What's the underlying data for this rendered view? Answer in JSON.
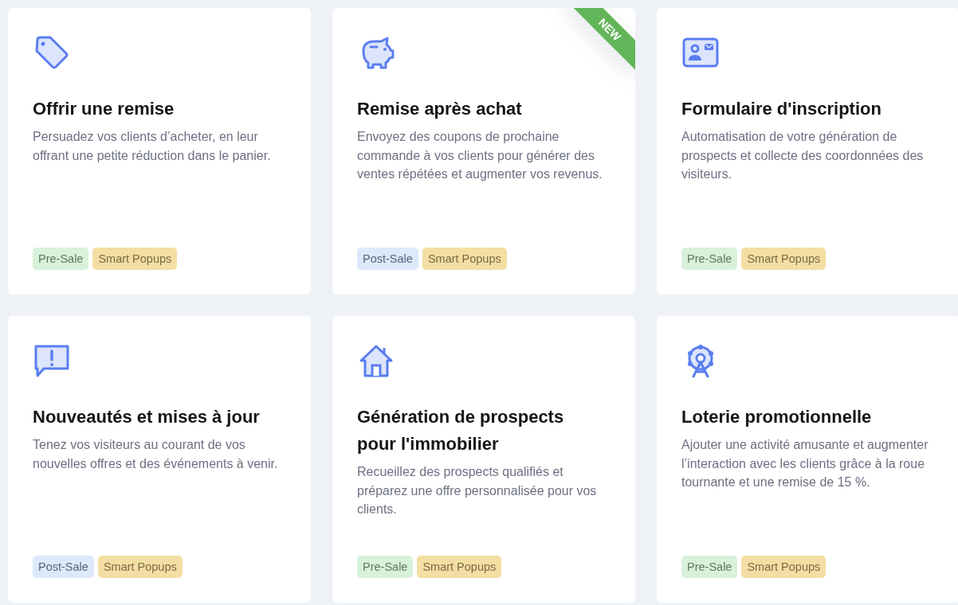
{
  "cards": [
    {
      "title": "Offrir une remise",
      "description": "Persuadez vos clients d’acheter, en leur offrant une petite réduction dans le panier.",
      "tags": [
        {
          "label": "Pre-Sale",
          "kind": "presale"
        },
        {
          "label": "Smart Popups",
          "kind": "smart"
        }
      ]
    },
    {
      "title": "Remise après achat",
      "description": "Envoyez des coupons de prochaine commande à vos clients pour générer des ventes répétées et augmenter vos revenus.",
      "ribbon": "NEW",
      "tags": [
        {
          "label": "Post-Sale",
          "kind": "postsale"
        },
        {
          "label": "Smart Popups",
          "kind": "smart"
        }
      ]
    },
    {
      "title": "Formulaire d'inscription",
      "description": "Automatisation de votre génération de prospects et collecte des coordonnées des visiteurs.",
      "tags": [
        {
          "label": "Pre-Sale",
          "kind": "presale"
        },
        {
          "label": "Smart Popups",
          "kind": "smart"
        }
      ]
    },
    {
      "title": "Nouveautés et mises à jour",
      "description": "Tenez vos visiteurs au courant de vos nouvelles offres et des événements à venir.",
      "tags": [
        {
          "label": "Post-Sale",
          "kind": "postsale"
        },
        {
          "label": "Smart Popups",
          "kind": "smart"
        }
      ]
    },
    {
      "title": "Génération de prospects pour l'immobilier",
      "description": "Recueillez des prospects qualifiés et préparez une offre personnalisée pour vos clients.",
      "tags": [
        {
          "label": "Pre-Sale",
          "kind": "presale"
        },
        {
          "label": "Smart Popups",
          "kind": "smart"
        }
      ]
    },
    {
      "title": "Loterie promotionnelle",
      "description": "Ajouter une activité amusante et augmenter l’interaction avec les clients grâce à la roue tournante et une remise de 15 %.",
      "tags": [
        {
          "label": "Pre-Sale",
          "kind": "presale"
        },
        {
          "label": "Smart Popups",
          "kind": "smart"
        }
      ]
    }
  ]
}
